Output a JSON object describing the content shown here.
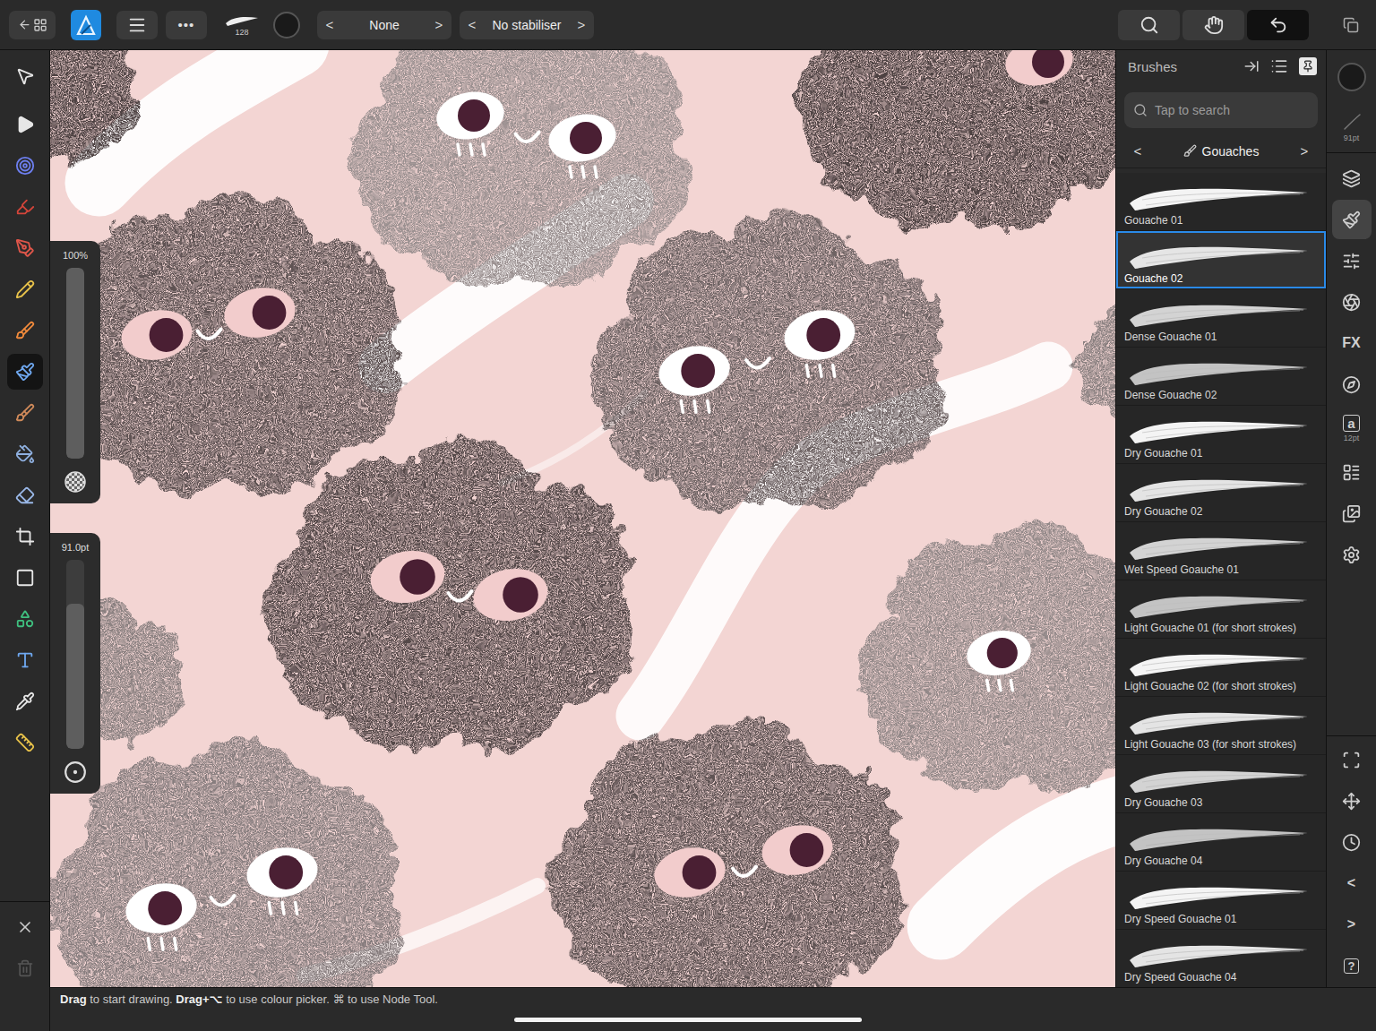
{
  "topbar": {
    "left_buttons": [
      {
        "kind": "back-home"
      },
      {
        "kind": "app-logo"
      },
      {
        "kind": "menu"
      },
      {
        "kind": "more",
        "glyph": "•••"
      }
    ],
    "brush_preview": {
      "size": "128"
    },
    "colour": {
      "color": "#1a1a1a"
    },
    "selectors": [
      {
        "kind": "blend-mode",
        "prev": "<",
        "value": "None",
        "next": ">"
      },
      {
        "kind": "stabiliser",
        "prev": "<",
        "value": "No stabiliser",
        "next": ">"
      }
    ],
    "right_buttons": [
      {
        "kind": "zoom",
        "selected": false
      },
      {
        "kind": "hand",
        "selected": false
      },
      {
        "kind": "undo",
        "selected": true
      }
    ],
    "corner_button": {
      "kind": "view-mode"
    }
  },
  "tools": [
    {
      "kind": "pointer",
      "selected": false
    },
    {
      "kind": "node",
      "selected": false
    },
    {
      "kind": "target",
      "selected": false
    },
    {
      "kind": "highlighter",
      "selected": false
    },
    {
      "kind": "pen",
      "selected": false
    },
    {
      "kind": "pencil",
      "selected": false
    },
    {
      "kind": "vector-brush",
      "selected": false
    },
    {
      "kind": "paint-brush",
      "selected": true
    },
    {
      "kind": "pixel-brush",
      "selected": false
    },
    {
      "kind": "fill",
      "selected": false
    },
    {
      "kind": "eraser",
      "selected": false
    },
    {
      "kind": "crop",
      "selected": false
    },
    {
      "kind": "rectangle",
      "selected": false
    },
    {
      "kind": "shape",
      "selected": false
    },
    {
      "kind": "text",
      "selected": false
    },
    {
      "kind": "colour-picker",
      "selected": false
    },
    {
      "kind": "ruler",
      "selected": false
    }
  ],
  "tool_actions": [
    {
      "kind": "close"
    },
    {
      "kind": "delete"
    }
  ],
  "sliders": [
    {
      "kind": "opacity",
      "label": "100%",
      "level": 1
    },
    {
      "kind": "size",
      "label": "91.0pt",
      "level": 0.77
    }
  ],
  "brushes_panel": {
    "title": "Brushes",
    "search": {
      "placeholder": "Tap to search"
    },
    "category": {
      "prev": "<",
      "name": "Gouaches",
      "next": ">"
    },
    "brushes": [
      {
        "name": "Gouache 01",
        "selected": false
      },
      {
        "name": "Gouache 02",
        "selected": true
      },
      {
        "name": "Dense Gouache 01",
        "selected": false
      },
      {
        "name": "Dense Gouache 02",
        "selected": false
      },
      {
        "name": "Dry Gouache 01",
        "selected": false
      },
      {
        "name": "Dry Gouache 02",
        "selected": false
      },
      {
        "name": "Wet Speed Goauche 01",
        "selected": false
      },
      {
        "name": "Light Gouache 01 (for short strokes)",
        "selected": false
      },
      {
        "name": "Light Gouache 02 (for short strokes)",
        "selected": false
      },
      {
        "name": "Light Gouache 03 (for short strokes)",
        "selected": false
      },
      {
        "name": "Dry Gouache 03",
        "selected": false
      },
      {
        "name": "Dry Gouache 04",
        "selected": false
      },
      {
        "name": "Dry Speed Gouache 01",
        "selected": false
      },
      {
        "name": "Dry Speed Gouache 04",
        "selected": false
      }
    ]
  },
  "studio": {
    "colour": {
      "color": "#1a1a1a"
    },
    "brush_width": {
      "label": "91pt"
    },
    "panels": [
      {
        "kind": "layers",
        "selected": false
      },
      {
        "kind": "brushes",
        "selected": true
      },
      {
        "kind": "adjustments",
        "selected": false
      },
      {
        "kind": "effects",
        "selected": false
      },
      {
        "kind": "fx",
        "glyph": "FX",
        "selected": false
      },
      {
        "kind": "navigator",
        "selected": false
      },
      {
        "kind": "text-styles",
        "glyph": "a",
        "label": "12pt",
        "selected": false
      },
      {
        "kind": "swatches",
        "selected": false
      },
      {
        "kind": "stock",
        "selected": false
      },
      {
        "kind": "assets",
        "selected": false
      }
    ],
    "controls": [
      {
        "kind": "transform"
      },
      {
        "kind": "move"
      },
      {
        "kind": "history"
      },
      {
        "kind": "previous",
        "glyph": "<"
      },
      {
        "kind": "next",
        "glyph": ">"
      },
      {
        "kind": "help",
        "glyph": "?"
      }
    ]
  },
  "status_bar": {
    "hint": [
      {
        "text": "Drag",
        "bold": true
      },
      {
        "text": " to start drawing. ",
        "bold": false
      },
      {
        "text": "Drag+⌥",
        "bold": true
      },
      {
        "text": " to use colour picker. ⌘ to use Node Tool.",
        "bold": false
      }
    ]
  }
}
